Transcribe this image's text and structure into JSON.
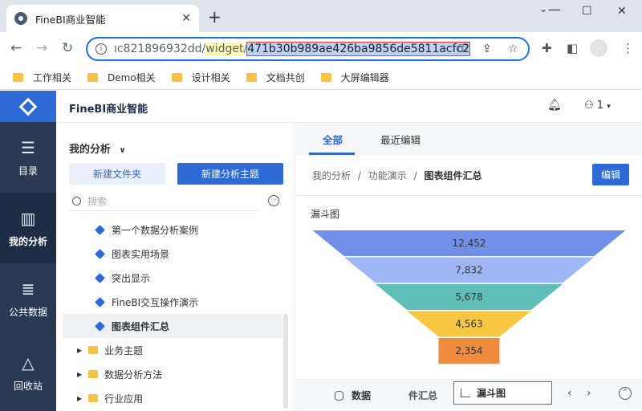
{
  "browser": {
    "tab_title": "FineBI商业智能",
    "tab_close": "✕",
    "new_tab": "+",
    "url_prefix": "ıc821896932dd/",
    "url_mid": "widget",
    "url_slash": "/",
    "url_selected": "471b30b989ae426ba9856de5811acfc2",
    "bookmarks": [
      "工作相关",
      "Demo相关",
      "设计相关",
      "文档共创",
      "大屏编辑器"
    ]
  },
  "app": {
    "brand": "FineBI商业智能",
    "user_label": "1",
    "rail": [
      {
        "label": "目录",
        "icon": "catalog-icon"
      },
      {
        "label": "我的分析",
        "icon": "analysis-icon"
      },
      {
        "label": "公共数据",
        "icon": "database-icon"
      },
      {
        "label": "回收站",
        "icon": "recycle-icon"
      }
    ]
  },
  "sidebar": {
    "title": "我的分析",
    "new_folder": "新建文件夹",
    "new_topic": "新建分析主题",
    "search_placeholder": "搜索",
    "items": [
      {
        "label": "第一个数据分析案例"
      },
      {
        "label": "图表实用场景"
      },
      {
        "label": "突出显示"
      },
      {
        "label": "FineBI交互操作演示"
      },
      {
        "label": "图表组件汇总"
      }
    ],
    "groups": [
      {
        "label": "业务主题"
      },
      {
        "label": "数据分析方法"
      },
      {
        "label": "行业应用"
      }
    ]
  },
  "main": {
    "tabs": [
      "全部",
      "最近编辑"
    ],
    "breadcrumb": [
      "我的分析",
      "功能演示",
      "图表组件汇总"
    ],
    "breadcrumb_sep": "/",
    "edit_button": "编辑",
    "chart_title": "漏斗图",
    "bottom": {
      "data_tab": "数据",
      "prev_tab": "件汇总",
      "active_tab": "漏斗图"
    }
  },
  "chart_data": {
    "type": "funnel",
    "title": "漏斗图",
    "values": [
      12452,
      7832,
      5678,
      4563,
      2354
    ],
    "labels": [
      "12,452",
      "7,832",
      "5,678",
      "4,563",
      "2,354"
    ],
    "colors": [
      "#6f8fe8",
      "#9fb7f4",
      "#5fbfb8",
      "#f8c742",
      "#f08a3c"
    ]
  }
}
